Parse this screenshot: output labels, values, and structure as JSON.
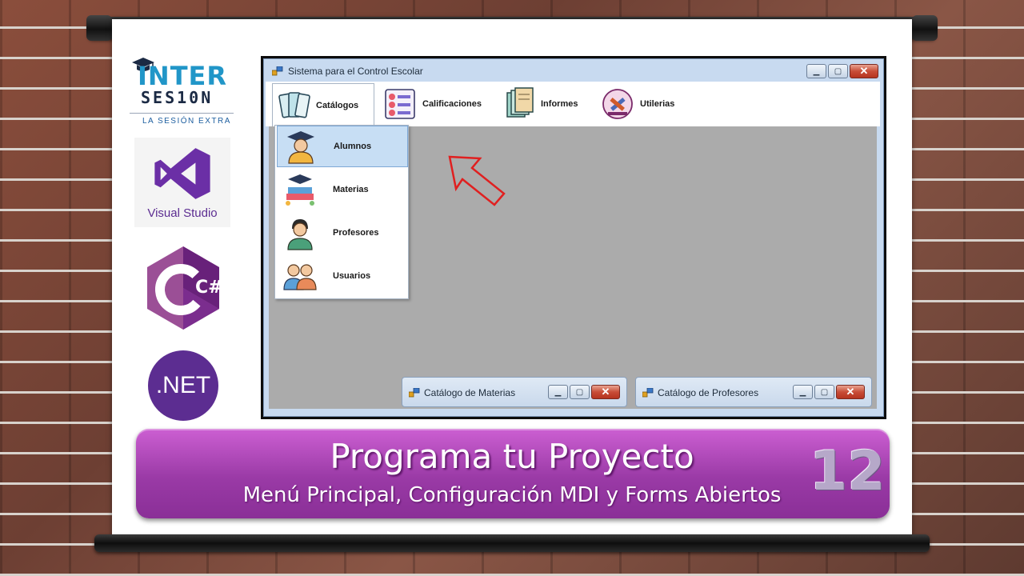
{
  "branding": {
    "inter": "INTER",
    "sesion": "SES10N",
    "tagline": "LA SESIÓN EXTRA",
    "visual_studio": "Visual Studio",
    "dotnet": ".NET",
    "csharp_glyph": "C#"
  },
  "app": {
    "title": "Sistema para el Control Escolar",
    "window_buttons": {
      "minimize": "minimize-icon",
      "maximize": "maximize-icon",
      "close": "close-icon"
    },
    "menu": [
      {
        "label": "Catálogos",
        "icon": "catalog-cards-icon",
        "active": true
      },
      {
        "label": "Calificaciones",
        "icon": "grades-checklist-icon"
      },
      {
        "label": "Informes",
        "icon": "reports-documents-icon"
      },
      {
        "label": "Utilerias",
        "icon": "tools-icon"
      }
    ],
    "dropdown": [
      {
        "label": "Alumnos",
        "icon": "student-graduate-icon",
        "highlighted": true
      },
      {
        "label": "Materias",
        "icon": "subjects-icon"
      },
      {
        "label": "Profesores",
        "icon": "teacher-icon"
      },
      {
        "label": "Usuarios",
        "icon": "users-icon"
      }
    ],
    "minimized_forms": [
      {
        "title": "Catálogo de Materias"
      },
      {
        "title": "Catálogo de Profesores"
      }
    ]
  },
  "banner": {
    "title": "Programa tu Proyecto",
    "subtitle": "Menú Principal, Configuración MDI y Forms Abiertos",
    "episode": "12"
  },
  "colors": {
    "client_area": "#ababab",
    "banner_purple": "#9a3aa6",
    "highlight": "#c7def4",
    "arrow": "#e02020"
  }
}
